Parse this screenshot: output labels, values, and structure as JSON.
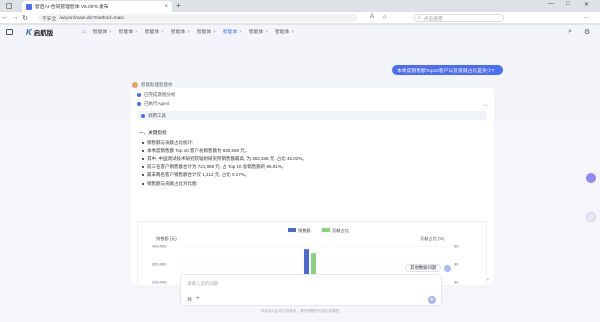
{
  "browser": {
    "tab_title": "智启AI-合同管理智体 V6.0/F5 发布",
    "new_tab": "+",
    "window_controls": [
      "—",
      "□",
      "✕"
    ],
    "security_label": "不安全",
    "url": "/aeyon/main.do?method=main",
    "search_placeholder": "点击搜索",
    "nav": [
      "←",
      "→",
      "↻",
      "⌂"
    ],
    "addr_icons": [
      "A",
      "☆",
      "…"
    ]
  },
  "app": {
    "logo_mark": "K",
    "logo_name": "启航版",
    "tabs": [
      {
        "label": "智能体",
        "active": false
      },
      {
        "label": "智能体",
        "active": false
      },
      {
        "label": "智能体",
        "active": false
      },
      {
        "label": "智能体",
        "active": false
      },
      {
        "label": "智能体",
        "active": false
      },
      {
        "label": "智能体",
        "active": true
      },
      {
        "label": "智能体",
        "active": false
      },
      {
        "label": "智能体",
        "active": false
      }
    ],
    "tab_close": "×"
  },
  "chat": {
    "user_message": "本季度销售额Top10客户以及贡献占比是多少?",
    "bot_name": "智能助理智能体",
    "steps": [
      "已完成意图分析",
      "已执行Agent"
    ],
    "tool_label": "调用工具",
    "section_title": "一、关键指标",
    "bullets": [
      "销售额与贡献占比统计:",
      "本季度销售额 Top 10 客户总销售额为 830,699 元。",
      "其中, 中国测试技术研究院辐射研究所销售额最高, 为 382,336 元, 占比 46.02%。",
      "前三名客户销售额合计为 721,969 元, 占 Top 10 总销售额的 86.91%。",
      "最末两名客户销售额合计仅 1,412 元, 占比 0.17%。",
      "销售额与贡献占比对比图:"
    ],
    "suggestion_button": "其他数据问题",
    "input_placeholder": "请输入您的问题",
    "footer": "内容由AI生成仅供参考，请仔细甄别内容的准确性"
  },
  "chart_data": {
    "type": "bar",
    "legend": [
      "销售额",
      "贡献占比"
    ],
    "ylabel_left": "销售额 (元)",
    "ylabel_right": "贡献占比 (%)",
    "yticks_left": [
      "400,000",
      "300,000",
      "200,000"
    ],
    "yticks_right": [
      "50",
      "40",
      "30"
    ],
    "series": [
      {
        "name": "销售额",
        "values": [
          382336
        ],
        "color": "#4a6bd0"
      },
      {
        "name": "贡献占比",
        "values": [
          46.02
        ],
        "color": "#8cd17d"
      }
    ]
  }
}
